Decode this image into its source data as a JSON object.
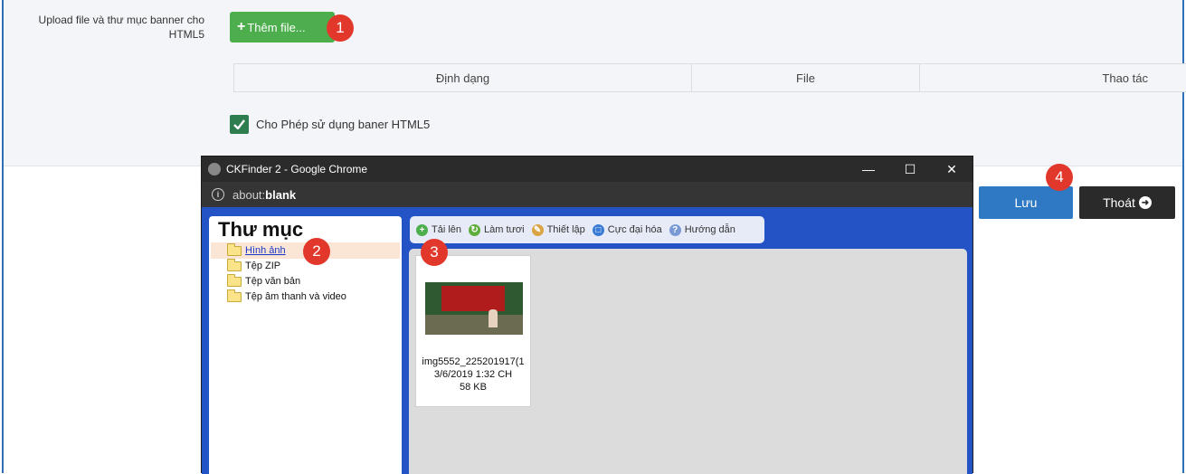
{
  "form": {
    "upload_label_line1": "Upload file và thư mục banner cho",
    "upload_label_line2": "HTML5",
    "add_file_label": "Thêm file...",
    "table_headers": [
      "Định dạng",
      "File",
      "Thao tác"
    ],
    "checkbox_label": "Cho Phép sử dụng baner HTML5",
    "save_label": "Lưu",
    "exit_label": "Thoát"
  },
  "badges": [
    "1",
    "2",
    "3",
    "4"
  ],
  "browser": {
    "title": "CKFinder 2 - Google Chrome",
    "url_prefix": "about:",
    "url_bold": "blank",
    "minimize": "—",
    "maximize": "☐",
    "close": "✕"
  },
  "ckfinder": {
    "folders_title": "Thư mục",
    "folders": [
      "Hình ảnh",
      "Tệp ZIP",
      "Tệp văn bản",
      "Tệp âm thanh và video"
    ],
    "toolbar": [
      "Tải lên",
      "Làm tươi",
      "Thiết lập",
      "Cực đại hóa",
      "Hướng dẫn"
    ],
    "file": {
      "name": "img5552_225201917(1",
      "date": "3/6/2019 1:32 CH",
      "size": "58 KB"
    }
  },
  "colors": {
    "green_button": "#4cae4c",
    "badge_red": "#e2382c",
    "save_blue": "#2f78c4",
    "exit_dark": "#2a2a2a",
    "ckfinder_blue": "#2353c4"
  }
}
